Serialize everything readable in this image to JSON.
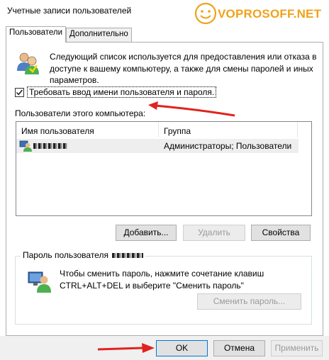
{
  "window": {
    "title": "Учетные записи пользователей"
  },
  "watermark": {
    "text": "VOPROSOFF.NET"
  },
  "tabs": [
    {
      "label": "Пользователи",
      "active": true
    },
    {
      "label": "Дополнительно",
      "active": false
    }
  ],
  "info": {
    "text": "Следующий список используется для предоставления или отказа в доступе к вашему компьютеру, а также для смены паролей и иных параметров."
  },
  "require_login": {
    "label": "Требовать ввод имени пользователя и пароля.",
    "checked": true
  },
  "users_list": {
    "label": "Пользователи этого компьютера:",
    "columns": [
      "Имя пользователя",
      "Группа"
    ],
    "rows": [
      {
        "name": "",
        "group": "Администраторы; Пользователи"
      }
    ]
  },
  "user_buttons": {
    "add": "Добавить...",
    "remove": "Удалить",
    "properties": "Свойства"
  },
  "password_group": {
    "label": "Пароль пользователя",
    "text": "Чтобы сменить пароль, нажмите сочетание клавиш CTRL+ALT+DEL и выберите \"Сменить пароль\"",
    "button": "Сменить пароль..."
  },
  "dialog_buttons": {
    "ok": "OK",
    "cancel": "Отмена",
    "apply": "Применить"
  },
  "colors": {
    "accent": "#0078d7",
    "arrow": "#e0231e",
    "watermark": "#f0a21a"
  }
}
